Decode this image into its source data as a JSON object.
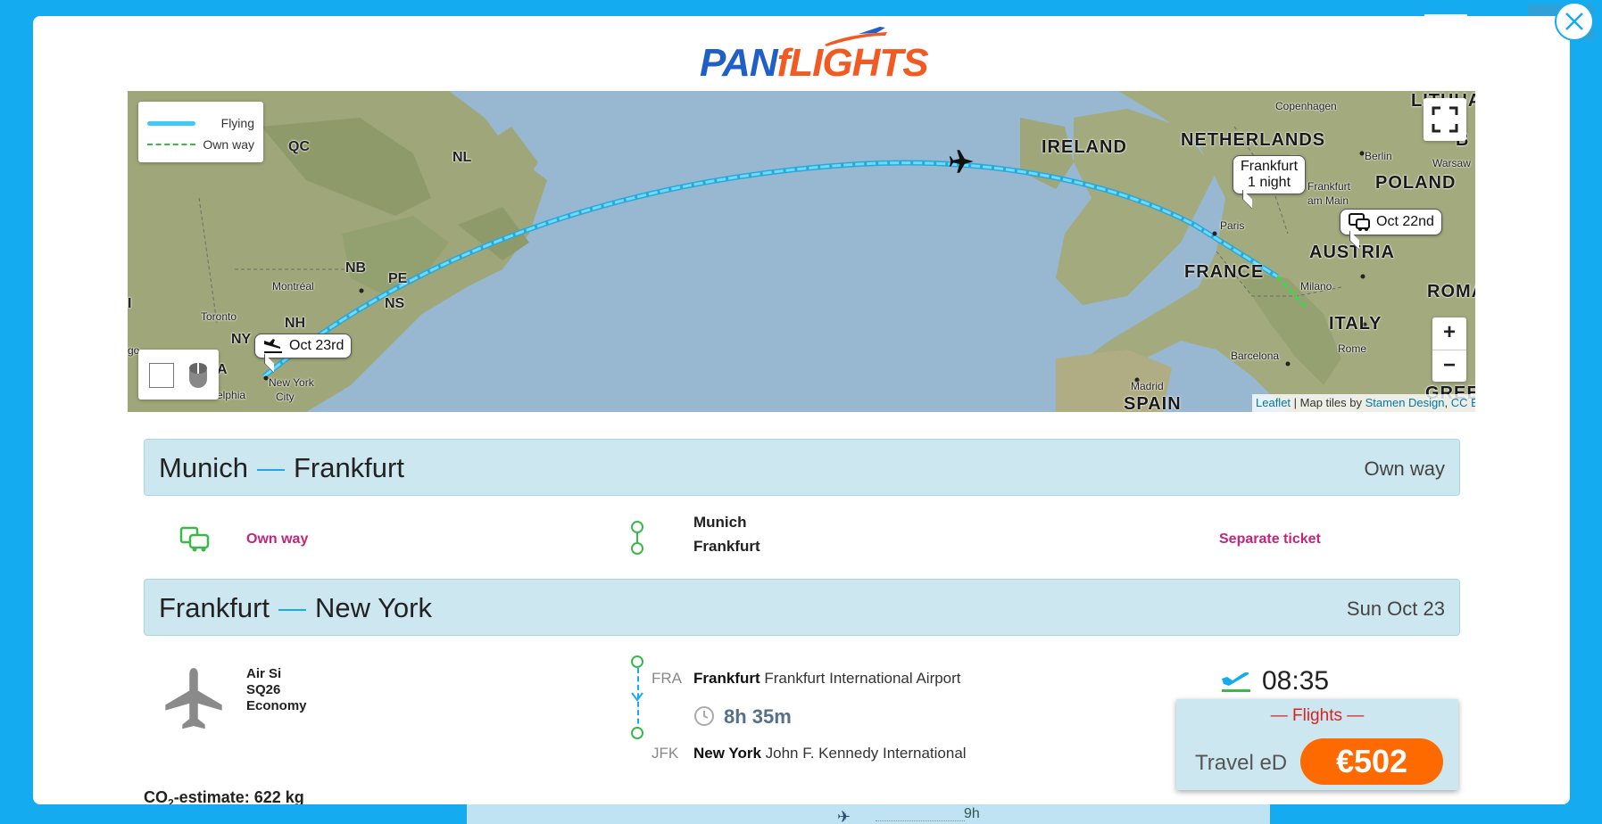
{
  "logo": {
    "part1": "PAN",
    "part2": "fLIGHTS"
  },
  "close": {
    "icon": "close-icon"
  },
  "map": {
    "legend": {
      "flying": "Flying",
      "own_way": "Own way"
    },
    "labels": {
      "qc": "QC",
      "nl": "NL",
      "nb": "NB",
      "pe": "PE",
      "ns": "NS",
      "nh": "NH",
      "ny": "NY",
      "a": "A",
      "go": "go",
      "i": "I",
      "montreal": "Montréal",
      "toronto": "Toronto",
      "new_york": "New York",
      "city": "City",
      "philadelphia": "elphia",
      "ireland": "IRELAND",
      "netherlands": "NETHERLANDS",
      "poland": "POLAND",
      "france": "FRANCE",
      "austria": "AUSTRIA",
      "italy": "ITALY",
      "spain": "SPAIN",
      "roma": "ROMA",
      "greece": "GREEC",
      "lithuania": "LITHUA",
      "b": "B",
      "bg": "B",
      "copenhagen": "Copenhagen",
      "berlin": "Berlin",
      "warsaw": "Warsaw",
      "frankfurt_am_main_1": "Frankfurt",
      "frankfurt_am_main_2": "am Main",
      "paris": "Paris",
      "milano": "Milano",
      "barcelona": "Barcelona",
      "rome": "Rome",
      "madrid": "Madrid",
      "m": "m"
    },
    "callouts": {
      "frankfurt_city": "Frankfurt",
      "frankfurt_night": "1 night",
      "oct22": "Oct 22nd",
      "oct23": "Oct 23rd"
    },
    "zoom_in": "+",
    "zoom_out": "−",
    "attribution": {
      "leaflet": "Leaflet",
      "sep": " | Map tiles by ",
      "stamen": "Stamen Design",
      "comma": ", ",
      "cc": "CC BY"
    }
  },
  "segment1": {
    "from": "Munich",
    "to": "Frankfurt",
    "right": "Own way",
    "mode_label": "Own way",
    "city_from": "Munich",
    "city_to": "Frankfurt",
    "ticket": "Separate ticket"
  },
  "segment2": {
    "from": "Frankfurt",
    "to": "New York",
    "right": "Sun Oct 23",
    "airline": "Air Si",
    "flight_no": "SQ26",
    "cabin": "Economy",
    "dep_code": "FRA",
    "dep_city": "Frankfurt",
    "dep_airport": "Frankfurt International Airport",
    "duration": "8h 35m",
    "arr_code": "JFK",
    "arr_city": "New York",
    "arr_airport": "John F. Kennedy International",
    "dep_time": "08:35"
  },
  "co2": {
    "prefix": "CO",
    "sub": "2",
    "suffix": "-estimate: 622 kg"
  },
  "price": {
    "flights_label": "— Flights —",
    "travel": "Travel eD",
    "amount": "€502"
  },
  "background": {
    "duration_partial": "9h"
  },
  "colors": {
    "accent": "#14abf1",
    "orange": "#ff6a00",
    "magenta": "#c2257a",
    "green": "#3cb84a"
  }
}
